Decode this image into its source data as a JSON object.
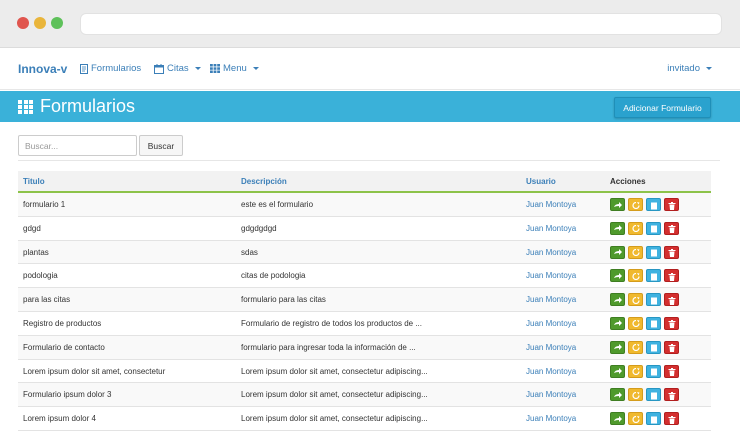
{
  "nav": {
    "brand": "Innova-v",
    "formularios": "Formularios",
    "citas": "Citas",
    "menu": "Menu",
    "user": "invitado"
  },
  "header": {
    "title": "Formularios",
    "add_button": "Adicionar Formulario"
  },
  "search": {
    "placeholder": "Buscar...",
    "value": "",
    "button": "Buscar"
  },
  "table": {
    "columns": [
      "Titulo",
      "Descripción",
      "Usuario",
      "Acciones"
    ],
    "rows": [
      {
        "titulo": "formulario 1",
        "descripcion": "este es el formulario",
        "usuario": "Juan Montoya"
      },
      {
        "titulo": "gdgd",
        "descripcion": "gdgdgdgd",
        "usuario": "Juan Montoya"
      },
      {
        "titulo": "plantas",
        "descripcion": "sdas",
        "usuario": "Juan Montoya"
      },
      {
        "titulo": "podologia",
        "descripcion": "citas de podologia",
        "usuario": "Juan Montoya"
      },
      {
        "titulo": "para las citas",
        "descripcion": "formulario para las citas",
        "usuario": "Juan Montoya"
      },
      {
        "titulo": "Registro de productos",
        "descripcion": "Formulario de registro de todos los productos de ...",
        "usuario": "Juan Montoya"
      },
      {
        "titulo": "Formulario de contacto",
        "descripcion": "formulario para ingresar toda la información de ...",
        "usuario": "Juan Montoya"
      },
      {
        "titulo": "Lorem ipsum dolor sit amet, consectetur",
        "descripcion": "Lorem ipsum dolor sit amet, consectetur adipiscing...",
        "usuario": "Juan Montoya"
      },
      {
        "titulo": "Formulario ipsum dolor 3",
        "descripcion": "Lorem ipsum dolor sit amet, consectetur adipiscing...",
        "usuario": "Juan Montoya"
      },
      {
        "titulo": "Lorem ipsum dolor 4",
        "descripcion": "Lorem ipsum dolor sit amet, consectetur adipiscing...",
        "usuario": "Juan Montoya"
      }
    ]
  },
  "icons": {
    "forms": "document-icon",
    "citas": "calendar-icon",
    "menu": "grid-icon",
    "actions": [
      "arrow-right-icon",
      "edit-icon",
      "view-icon",
      "trash-icon"
    ]
  },
  "colors": {
    "primary": "#3ab1d9",
    "link": "#3b7fb8",
    "accent_green": "#8dc34a",
    "action_go": "#4f9a2c",
    "action_edit": "#f0b92e",
    "action_view": "#3fb2e0",
    "action_delete": "#d32f2f"
  }
}
